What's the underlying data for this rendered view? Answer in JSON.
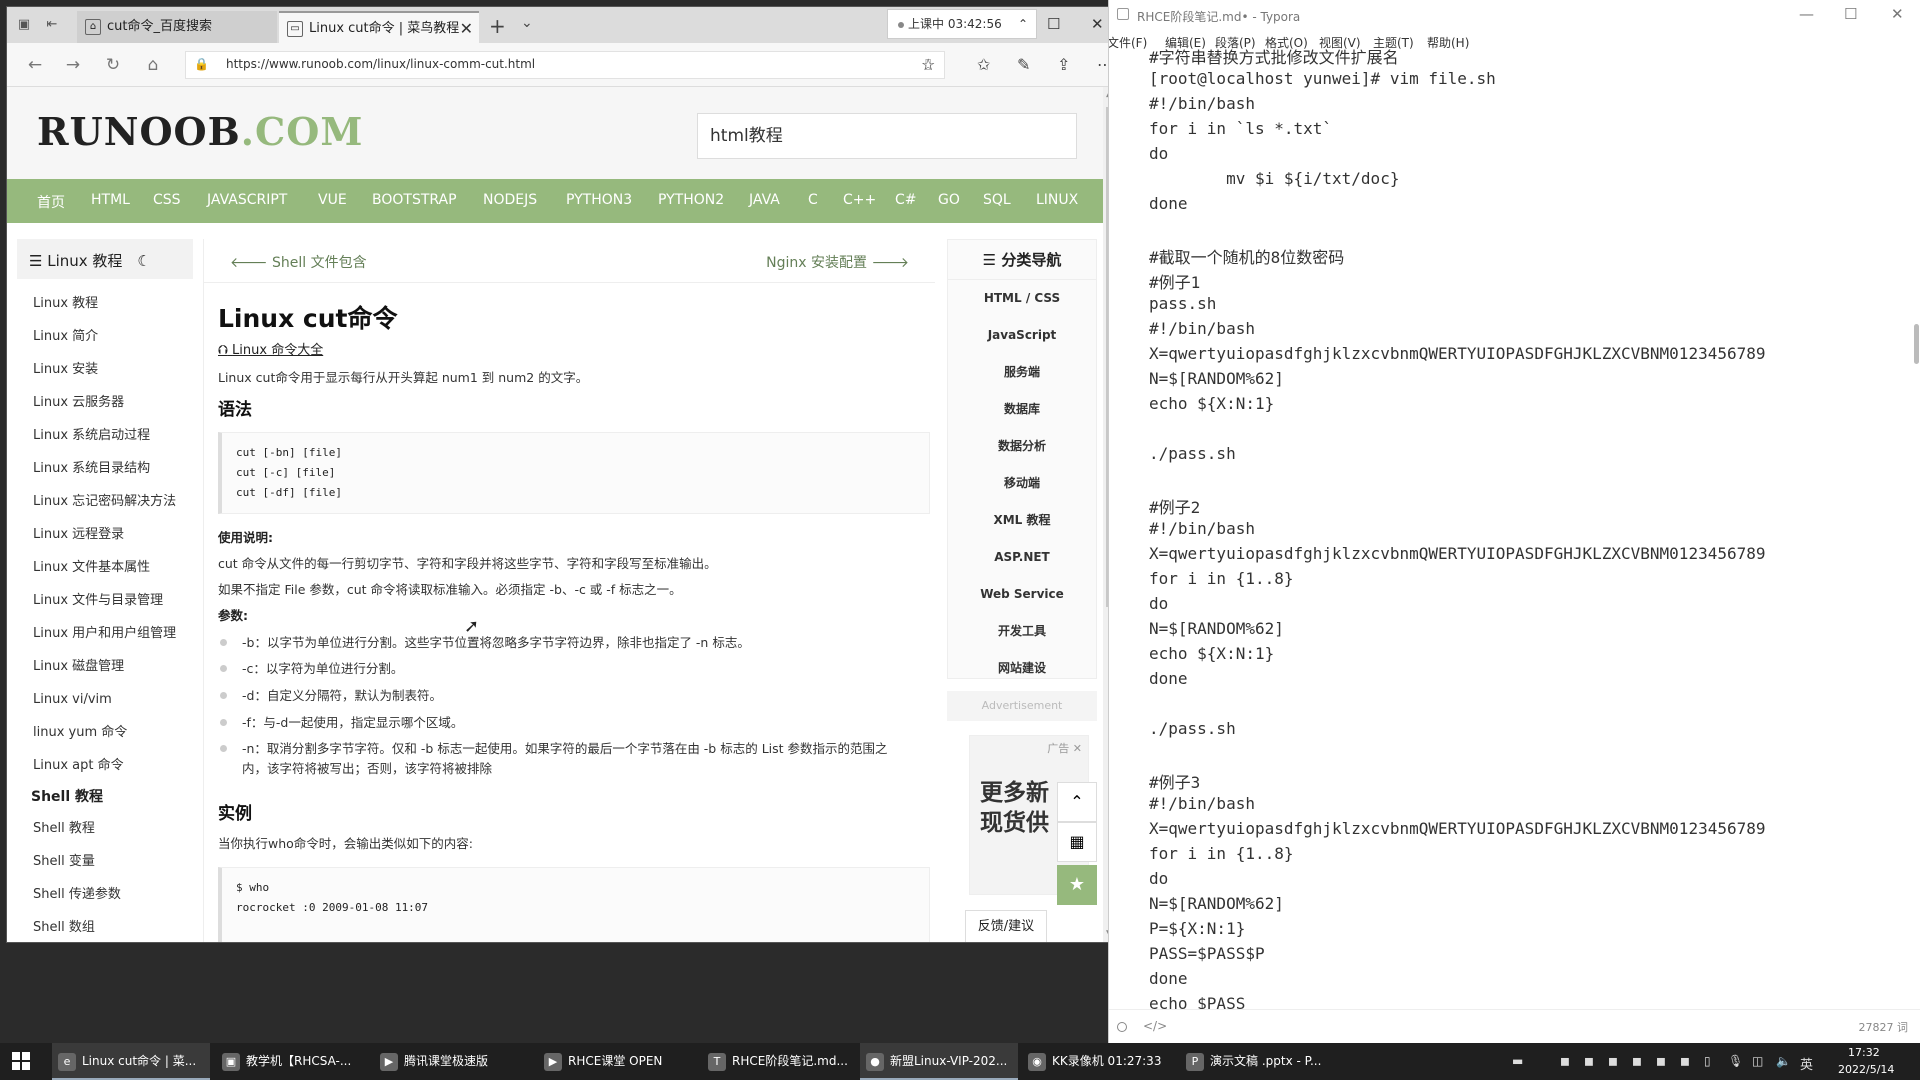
{
  "browser": {
    "tabs": [
      {
        "label": "cut命令_百度搜索",
        "icon": "baidu-icon"
      },
      {
        "label": "Linux cut命令 | 菜鸟教程",
        "icon": "page-icon"
      }
    ],
    "timer": "上课中 03:42:56",
    "url": "https://www.runoob.com/linux/linux-comm-cut.html"
  },
  "site": {
    "logo_main": "RUNOOB",
    "logo_suffix": ".COM",
    "search_value": "html教程",
    "nav": [
      "首页",
      "HTML",
      "CSS",
      "JAVASCRIPT",
      "VUE",
      "BOOTSTRAP",
      "NODEJS",
      "PYTHON3",
      "PYTHON2",
      "JAVA",
      "C",
      "C++",
      "C#",
      "GO",
      "SQL",
      "LINUX"
    ],
    "sidebar_title": "Linux 教程",
    "sidebar_items": [
      "Linux 教程",
      "Linux 简介",
      "Linux 安装",
      "Linux 云服务器",
      "Linux 系统启动过程",
      "Linux 系统目录结构",
      "Linux 忘记密码解决方法",
      "Linux 远程登录",
      "Linux 文件基本属性",
      "Linux 文件与目录管理",
      "Linux 用户和用户组管理",
      "Linux 磁盘管理",
      "Linux vi/vim",
      "linux yum 命令",
      "Linux apt 命令"
    ],
    "sidebar_section2": "Shell 教程",
    "sidebar_items2": [
      "Shell 教程",
      "Shell 变量",
      "Shell 传递参数",
      "Shell 数组"
    ],
    "prev": "Shell 文件包含",
    "next": "Nginx 安装配置",
    "title": "Linux cut命令",
    "crumb": "Linux 命令大全",
    "intro": "Linux cut命令用于显示每行从开头算起 num1 到 num2 的文字。",
    "syntax_heading": "语法",
    "syntax_lines": [
      "cut  [-bn] [file]",
      "cut [-c] [file]",
      "cut [-df] [file]"
    ],
    "usage_label": "使用说明:",
    "usage1": "cut 命令从文件的每一行剪切字节、字符和字段并将这些字节、字符和字段写至标准输出。",
    "usage2": "如果不指定 File 参数，cut 命令将读取标准输入。必须指定 -b、-c 或 -f 标志之一。",
    "params_label": "参数:",
    "params": [
      "-b：以字节为单位进行分割。这些字节位置将忽略多字节字符边界，除非也指定了 -n 标志。",
      "-c：以字符为单位进行分割。",
      "-d：自定义分隔符，默认为制表符。",
      "-f：与-d一起使用，指定显示哪个区域。",
      "-n：取消分割多字节字符。仅和 -b 标志一起使用。如果字符的最后一个字节落在由 -b 标志的 List 参数指示的范围之内，该字符将被写出；否则，该字符将被排除"
    ],
    "example_heading": "实例",
    "example_desc": "当你执行who命令时，会输出类似如下的内容:",
    "example_code": [
      "$ who",
      "rocrocket :0           2009-01-08 11:07"
    ],
    "rightnav_title": "分类导航",
    "rightnav_items": [
      "HTML / CSS",
      "JavaScript",
      "服务端",
      "数据库",
      "数据分析",
      "移动端",
      "XML 教程",
      "ASP.NET",
      "Web Service",
      "开发工具",
      "网站建设"
    ],
    "ad_label": "Advertisement",
    "ad_tag": "广告",
    "ad_text": [
      "更多新",
      "现货供"
    ],
    "feedback": "反馈/建议"
  },
  "typora": {
    "title": "RHCE阶段笔记.md• - Typora",
    "menu": [
      "文件(F)",
      "编辑(E)",
      "段落(P)",
      "格式(O)",
      "视图(V)",
      "主题(T)",
      "帮助(H)"
    ],
    "lines": [
      "#字符串替换方式批修改文件扩展名",
      "[root@localhost yunwei]# vim file.sh",
      "#!/bin/bash",
      "for i in `ls *.txt`",
      "do",
      "        mv $i ${i/txt/doc}",
      "done",
      "",
      "#截取一个随机的8位数密码",
      "#例子1",
      "pass.sh",
      "#!/bin/bash",
      "X=qwertyuiopasdfghjklzxcvbnmQWERTYUIOPASDFGHJKLZXCVBNM0123456789",
      "N=$[RANDOM%62]",
      "echo ${X:N:1}",
      "",
      "./pass.sh",
      "",
      "#例子2",
      "#!/bin/bash",
      "X=qwertyuiopasdfghjklzxcvbnmQWERTYUIOPASDFGHJKLZXCVBNM0123456789",
      "for i in {1..8}",
      "do",
      "N=$[RANDOM%62]",
      "echo ${X:N:1}",
      "done",
      "",
      "./pass.sh",
      "",
      "#例子3",
      "#!/bin/bash",
      "X=qwertyuiopasdfghjklzxcvbnmQWERTYUIOPASDFGHJKLZXCVBNM0123456789",
      "for i in {1..8}",
      "do",
      "N=$[RANDOM%62]",
      "P=${X:N:1}",
      "PASS=$PASS$P",
      "done",
      "echo $PASS"
    ],
    "status_code": "</>",
    "word_count": "27827 词"
  },
  "taskbar": {
    "items": [
      "Linux cut命令 | 菜...",
      "教学机【RHCSA-...",
      "腾讯课堂极速版",
      "RHCE课堂 OPEN",
      "RHCE阶段笔记.md...",
      "新盟Linux-VIP-202...",
      "KK录像机 01:27:33",
      "演示文稿 .pptx - P..."
    ],
    "ime": "英",
    "time": "17:32",
    "date": "2022/5/14"
  }
}
